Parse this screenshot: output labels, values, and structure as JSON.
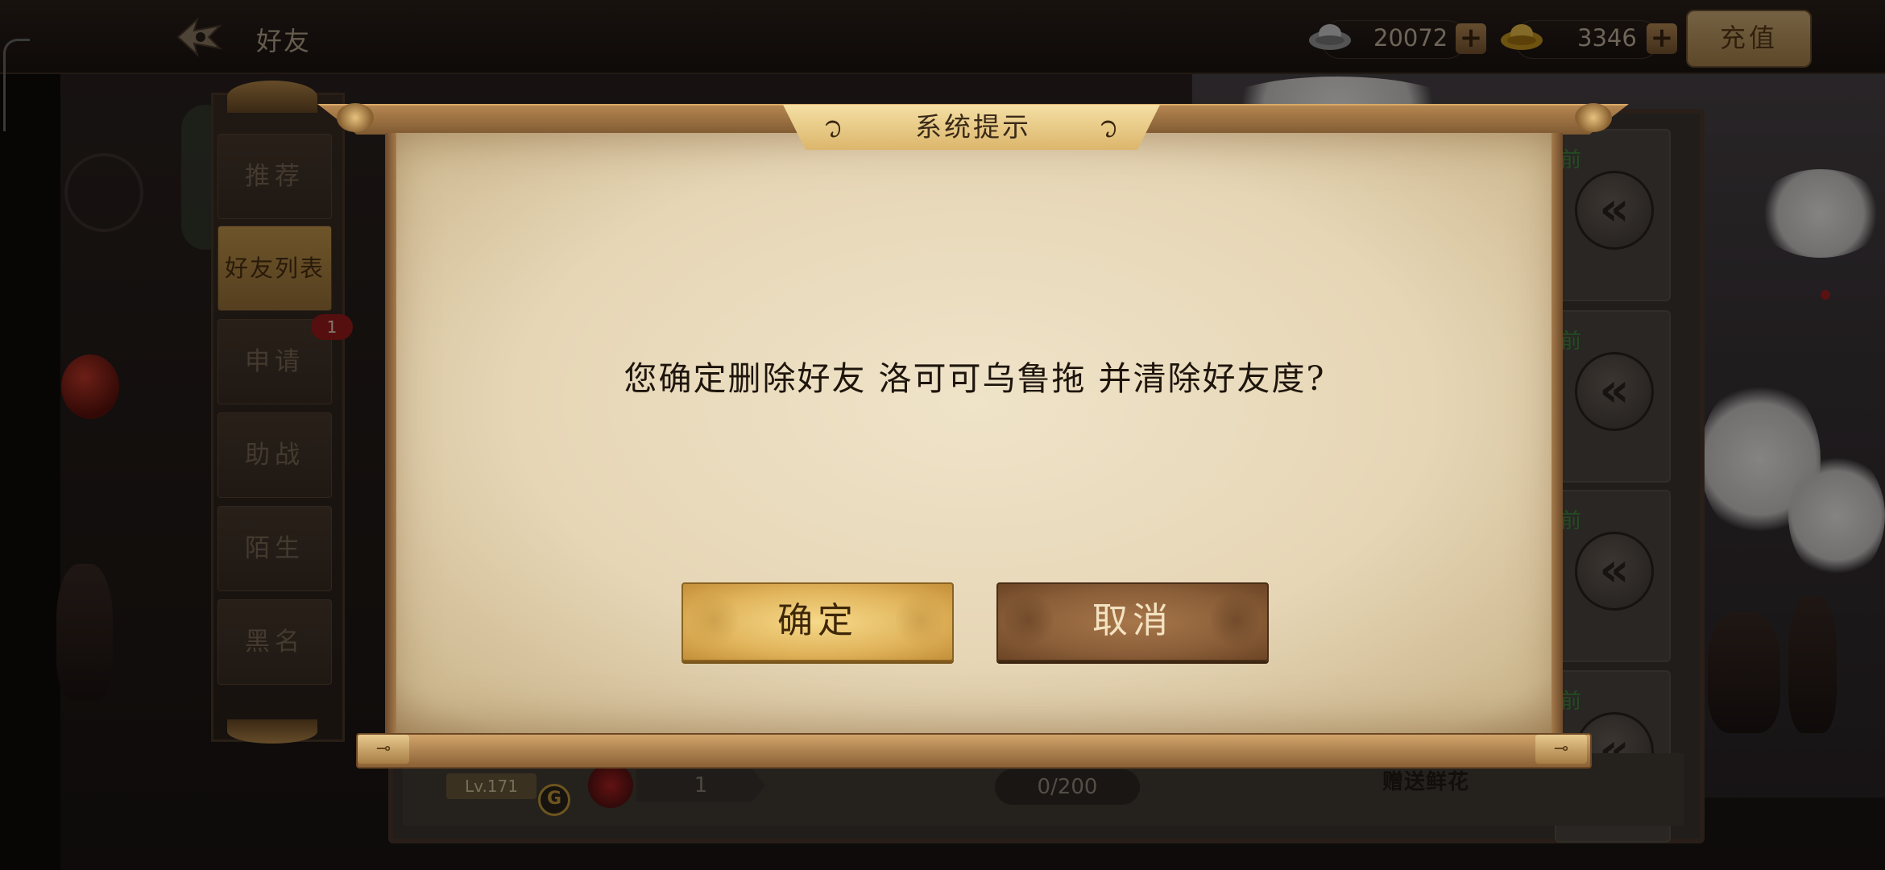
{
  "header": {
    "title": "好友",
    "silver": "20072",
    "gold": "3346",
    "recharge_label": "充值"
  },
  "tabs": [
    {
      "label": "推荐"
    },
    {
      "label": "好友列表"
    },
    {
      "label": "申请"
    },
    {
      "label": "助战"
    },
    {
      "label": "陌生"
    },
    {
      "label": "黑名"
    }
  ],
  "request_badge": "1",
  "list": {
    "front_label": "前",
    "level": "Lv.171",
    "g_badge": "G",
    "rose_count": "1",
    "capacity": "0/200",
    "gift_label": "赠送鲜花"
  },
  "dialog": {
    "title": "系统提示",
    "message": "您确定删除好友 洛可可乌鲁拖 并清除好友度?",
    "confirm_label": "确定",
    "cancel_label": "取消"
  },
  "colors": {
    "dialog_paper": "#e9dcc0",
    "confirm_gold": "#e0b35a",
    "cancel_brown": "#8a5e38",
    "active_tab": "#c99a4c"
  }
}
